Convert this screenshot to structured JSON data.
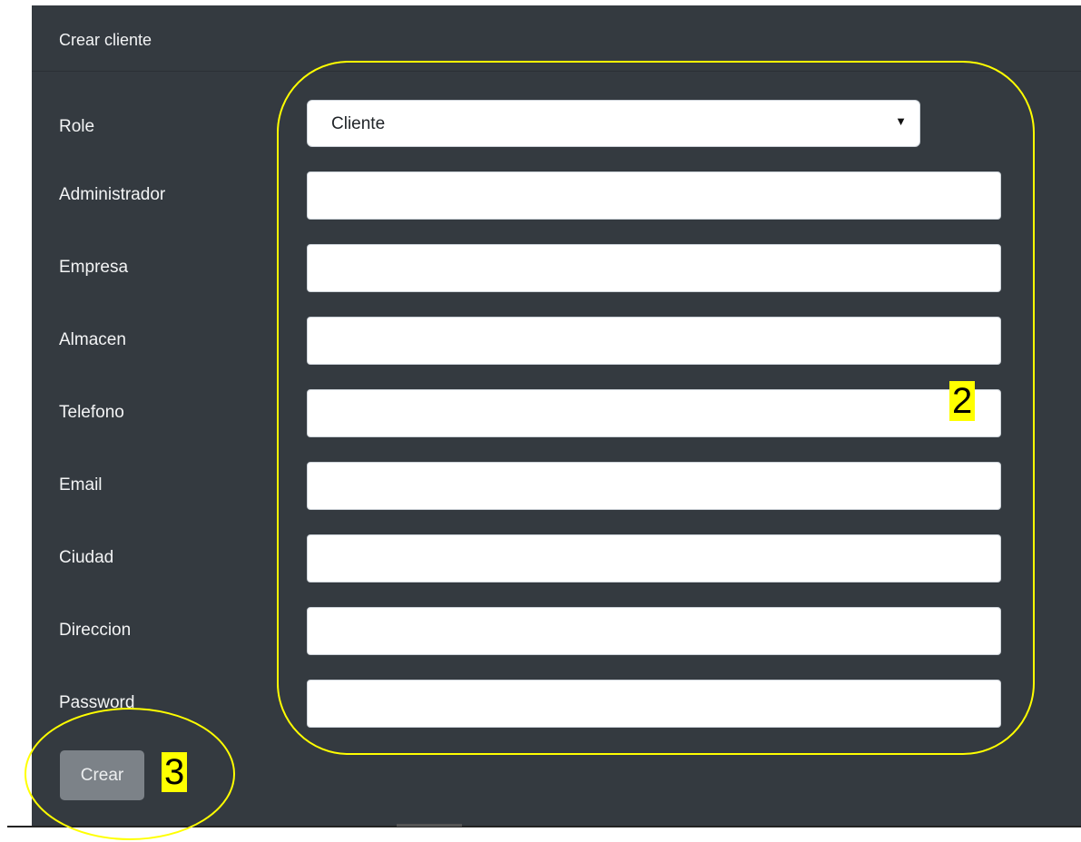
{
  "card": {
    "title": "Crear cliente"
  },
  "form": {
    "role": {
      "label": "Role",
      "selected": "Cliente"
    },
    "fields": [
      {
        "label": "Administrador",
        "value": ""
      },
      {
        "label": "Empresa",
        "value": ""
      },
      {
        "label": "Almacen",
        "value": ""
      },
      {
        "label": "Telefono",
        "value": ""
      },
      {
        "label": "Email",
        "value": ""
      },
      {
        "label": "Ciudad",
        "value": ""
      },
      {
        "label": "Direccion",
        "value": ""
      },
      {
        "label": "Password",
        "value": ""
      }
    ],
    "submit_label": "Crear"
  },
  "annotations": {
    "marker_fields": "2",
    "marker_submit": "3",
    "highlight_color": "#ffff00"
  },
  "icons": {
    "select_caret": "chevron-down-icon"
  },
  "colors": {
    "card_bg": "#343a40",
    "button_bg": "#7c8288"
  }
}
